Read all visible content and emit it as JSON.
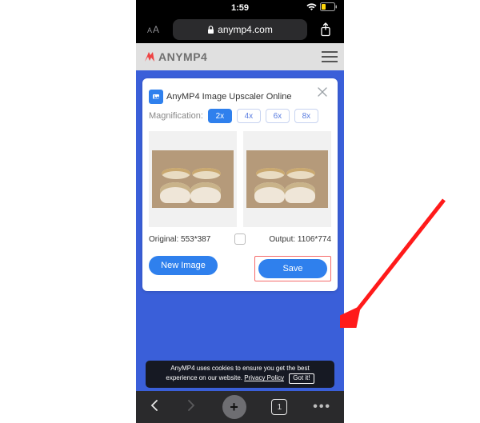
{
  "status": {
    "time": "1:59"
  },
  "safari": {
    "domain": "anymp4.com",
    "tab_count": "1"
  },
  "site": {
    "brand": "ANYMP4"
  },
  "modal": {
    "title": "AnyMP4 Image Upscaler Online",
    "magnification_label": "Magnification:",
    "options": [
      "2x",
      "4x",
      "6x",
      "8x"
    ],
    "selected_option": "2x",
    "original_label": "Original: 553*387",
    "output_label": "Output: 1106*774",
    "new_image_label": "New Image",
    "save_label": "Save"
  },
  "cookie": {
    "line1": "AnyMP4 uses cookies to ensure you get the best",
    "line2_prefix": "experience on our website.",
    "privacy": "Privacy Policy",
    "gotit": "Got it!"
  }
}
